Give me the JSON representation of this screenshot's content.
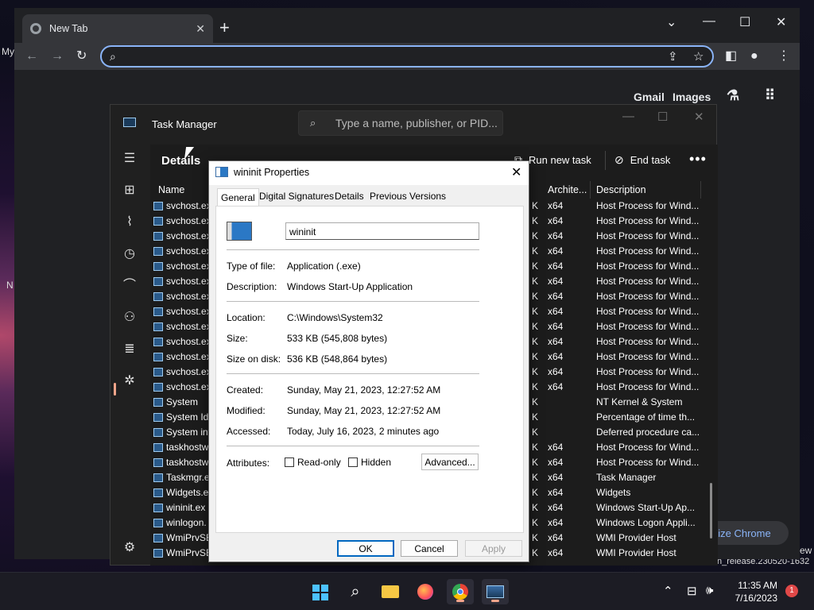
{
  "desktop": {
    "left_text_1": "My",
    "left_text_2": "N",
    "bottom_right_text_1": "ew",
    "bottom_right_text_2": "n_release.230520-1632"
  },
  "chrome": {
    "tab_title": "New Tab",
    "tab_close": "✕",
    "new_tab": "+",
    "omnibox_placeholder": "",
    "links": [
      "Gmail",
      "Images"
    ],
    "customize_label": "nize Chrome"
  },
  "task_manager": {
    "title": "Task Manager",
    "search_placeholder": "Type a name, publisher, or PID...",
    "page_title": "Details",
    "run_new_task": "Run new task",
    "end_task": "End task",
    "more": "•••",
    "columns": {
      "name": "Name",
      "arch": "Archite...",
      "description": "Description"
    },
    "rows": [
      {
        "name": "svchost.ex",
        "k": "K",
        "arch": "x64",
        "desc": "Host Process for Wind..."
      },
      {
        "name": "svchost.ex",
        "k": "K",
        "arch": "x64",
        "desc": "Host Process for Wind..."
      },
      {
        "name": "svchost.ex",
        "k": "K",
        "arch": "x64",
        "desc": "Host Process for Wind..."
      },
      {
        "name": "svchost.ex",
        "k": "K",
        "arch": "x64",
        "desc": "Host Process for Wind..."
      },
      {
        "name": "svchost.ex",
        "k": "K",
        "arch": "x64",
        "desc": "Host Process for Wind..."
      },
      {
        "name": "svchost.ex",
        "k": "K",
        "arch": "x64",
        "desc": "Host Process for Wind..."
      },
      {
        "name": "svchost.ex",
        "k": "K",
        "arch": "x64",
        "desc": "Host Process for Wind..."
      },
      {
        "name": "svchost.ex",
        "k": "K",
        "arch": "x64",
        "desc": "Host Process for Wind..."
      },
      {
        "name": "svchost.ex",
        "k": "K",
        "arch": "x64",
        "desc": "Host Process for Wind..."
      },
      {
        "name": "svchost.ex",
        "k": "K",
        "arch": "x64",
        "desc": "Host Process for Wind..."
      },
      {
        "name": "svchost.ex",
        "k": "K",
        "arch": "x64",
        "desc": "Host Process for Wind..."
      },
      {
        "name": "svchost.ex",
        "k": "K",
        "arch": "x64",
        "desc": "Host Process for Wind..."
      },
      {
        "name": "svchost.ex",
        "k": "K",
        "arch": "x64",
        "desc": "Host Process for Wind..."
      },
      {
        "name": "System",
        "k": "K",
        "arch": "",
        "desc": "NT Kernel & System"
      },
      {
        "name": "System Idl",
        "k": "K",
        "arch": "",
        "desc": "Percentage of time th..."
      },
      {
        "name": "System int",
        "k": "K",
        "arch": "",
        "desc": "Deferred procedure ca..."
      },
      {
        "name": "taskhostw",
        "k": "K",
        "arch": "x64",
        "desc": "Host Process for Wind..."
      },
      {
        "name": "taskhostw",
        "k": "K",
        "arch": "x64",
        "desc": "Host Process for Wind..."
      },
      {
        "name": "Taskmgr.e",
        "k": "K",
        "arch": "x64",
        "desc": "Task Manager"
      },
      {
        "name": "Widgets.e",
        "k": "K",
        "arch": "x64",
        "desc": "Widgets"
      },
      {
        "name": "wininit.ex",
        "k": "K",
        "arch": "x64",
        "desc": "Windows Start-Up Ap..."
      },
      {
        "name": "winlogon.",
        "k": "K",
        "arch": "x64",
        "desc": "Windows Logon Appli..."
      },
      {
        "name": "WmiPrvSE",
        "k": "K",
        "arch": "x64",
        "desc": "WMI Provider Host"
      },
      {
        "name": "WmiPrvSE",
        "k": "K",
        "arch": "x64",
        "desc": "WMI Provider Host"
      }
    ]
  },
  "dialog": {
    "title": "wininit Properties",
    "close": "✕",
    "tabs": [
      "General",
      "Digital Signatures",
      "Details",
      "Previous Versions"
    ],
    "file_name": "wininit",
    "type_label": "Type of file:",
    "type_value": "Application (.exe)",
    "desc_label": "Description:",
    "desc_value": "Windows Start-Up Application",
    "location_label": "Location:",
    "location_value": "C:\\Windows\\System32",
    "size_label": "Size:",
    "size_value": "533 KB (545,808 bytes)",
    "size_disk_label": "Size on disk:",
    "size_disk_value": "536 KB (548,864 bytes)",
    "created_label": "Created:",
    "created_value": "Sunday, May 21, 2023, 12:27:52 AM",
    "modified_label": "Modified:",
    "modified_value": "Sunday, May 21, 2023, 12:27:52 AM",
    "accessed_label": "Accessed:",
    "accessed_value": "Today, July 16, 2023, 2 minutes ago",
    "attributes_label": "Attributes:",
    "readonly_label": "Read-only",
    "hidden_label": "Hidden",
    "advanced_label": "Advanced...",
    "ok_label": "OK",
    "cancel_label": "Cancel",
    "apply_label": "Apply"
  },
  "taskbar": {
    "time": "11:35 AM",
    "date": "7/16/2023",
    "notification_count": "1"
  },
  "colors": {
    "accent": "#0067c0",
    "chrome_focus": "#8ab4f8",
    "taskbar_indicator": "#f4a58a"
  }
}
